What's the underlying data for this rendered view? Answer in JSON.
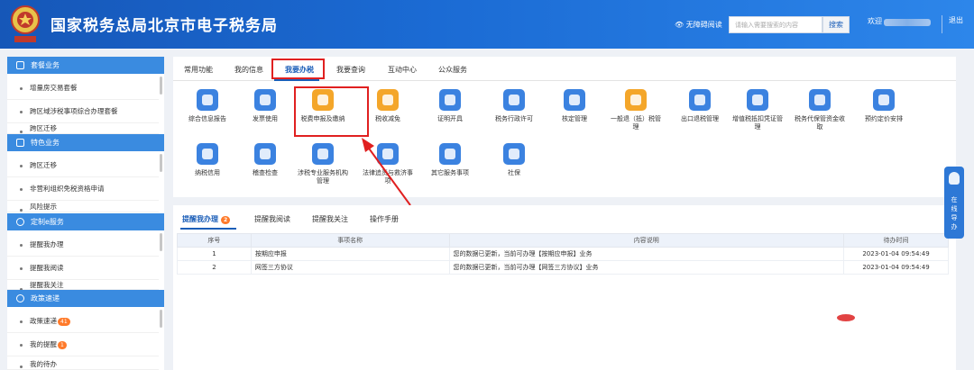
{
  "header": {
    "title": "国家税务总局北京市电子税务局",
    "accessibility": "无障碍阅读",
    "search_placeholder": "请输入需要搜索的内容",
    "search_button": "搜索",
    "welcome": "欢迎",
    "logout": "退出"
  },
  "sidebar": {
    "sections": [
      {
        "title": "套餐业务",
        "items": [
          "增量房交易套餐",
          "跨区域涉税事项综合办理套餐",
          "跨区迁移"
        ]
      },
      {
        "title": "特色业务",
        "items": [
          "跨区迁移",
          "非营利组织免税资格申请",
          "风险提示"
        ]
      },
      {
        "title": "定制e服务",
        "items": [
          "提醒我办理",
          "提醒我阅读",
          "提醒我关注"
        ]
      },
      {
        "title": "政策速递",
        "items": [
          "政策速递",
          "我的提醒",
          "我的待办"
        ]
      }
    ],
    "badges": {
      "policy": "41",
      "reminder": "1"
    }
  },
  "tabs": [
    "常用功能",
    "我的信息",
    "我要办税",
    "我要查询",
    "互动中心",
    "公众服务"
  ],
  "services": [
    {
      "label": "综合信息报告",
      "icon": "document-list-icon",
      "color": "#3b82e0"
    },
    {
      "label": "发票使用",
      "icon": "invoice-check-icon",
      "color": "#3b82e0"
    },
    {
      "label": "税费申报及缴纳",
      "icon": "yuan-wallet-icon",
      "color": "#f4a62a"
    },
    {
      "label": "税收减免",
      "icon": "coin-icon",
      "color": "#f4a62a"
    },
    {
      "label": "证明开具",
      "icon": "certificate-icon",
      "color": "#3b82e0"
    },
    {
      "label": "税务行政许可",
      "icon": "person-card-icon",
      "color": "#3b82e0"
    },
    {
      "label": "核定管理",
      "icon": "user-gear-icon",
      "color": "#3b82e0"
    },
    {
      "label": "一般退（抵）税管理",
      "icon": "refund-yuan-icon",
      "color": "#f4a62a"
    },
    {
      "label": "出口退税管理",
      "icon": "globe-icon",
      "color": "#3b82e0"
    },
    {
      "label": "增值税抵扣凭证管理",
      "icon": "voucher-grid-icon",
      "color": "#3b82e0"
    },
    {
      "label": "税务代保管资金收取",
      "icon": "money-bag-icon",
      "color": "#3b82e0"
    },
    {
      "label": "预约定价安排",
      "icon": "clock-check-icon",
      "color": "#3b82e0"
    },
    {
      "label": "纳税信用",
      "icon": "shield-heart-icon",
      "color": "#3b82e0"
    },
    {
      "label": "稽查检查",
      "icon": "inspector-icon",
      "color": "#3b82e0"
    },
    {
      "label": "涉税专业服务机构管理",
      "icon": "agent-user-icon",
      "color": "#3b82e0"
    },
    {
      "label": "法律追责与救济事项",
      "icon": "gavel-icon",
      "color": "#3b82e0"
    },
    {
      "label": "其它服务事项",
      "icon": "list-doc-icon",
      "color": "#3b82e0"
    },
    {
      "label": "社保",
      "icon": "social-insurance-icon",
      "color": "#3b82e0"
    }
  ],
  "lower_tabs": [
    {
      "label": "提醒我办理",
      "badge": "2"
    },
    {
      "label": "提醒我阅读"
    },
    {
      "label": "提醒我关注"
    },
    {
      "label": "操作手册"
    }
  ],
  "table": {
    "headers": [
      "序号",
      "事项名称",
      "内容说明",
      "待办时间"
    ],
    "rows": [
      [
        "1",
        "按期应申报",
        "您的数据已更新，当前可办理【按期应申报】业务",
        "2023-01-04 09:54:49"
      ],
      [
        "2",
        "网签三方协议",
        "您的数据已更新，当前可办理【网签三方协议】业务",
        "2023-01-04 09:54:49"
      ]
    ]
  },
  "float_button": "在线导办",
  "colors": {
    "header": "#1b6bd4",
    "accent": "#1b5eb8",
    "highlight": "#e02020",
    "badge": "#ff7a2a"
  }
}
